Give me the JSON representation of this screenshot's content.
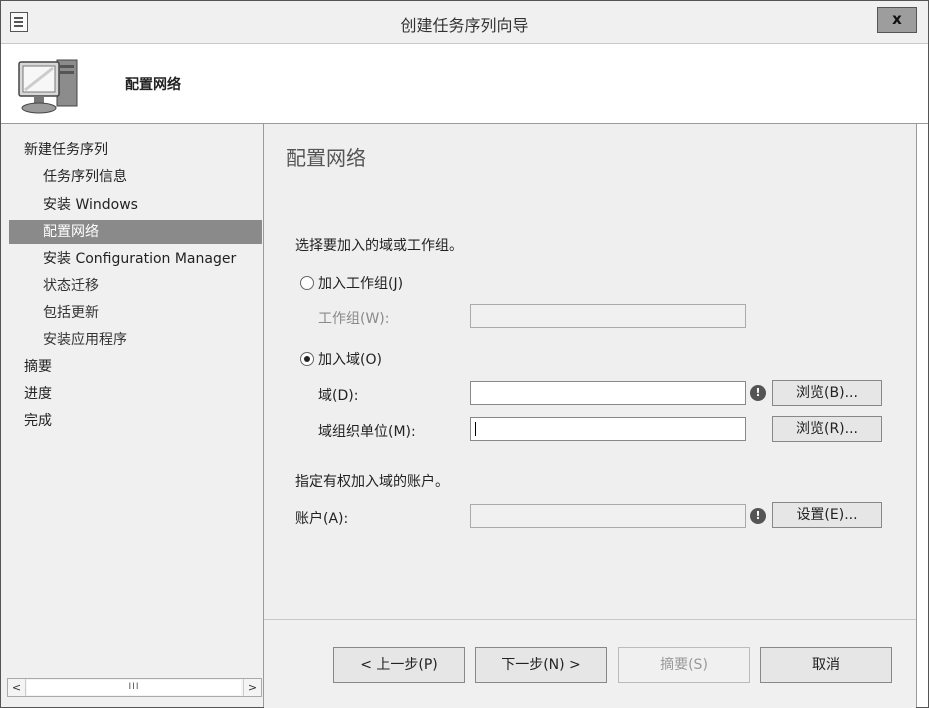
{
  "window": {
    "title": "创建任务序列向导",
    "close_label": "x"
  },
  "header": {
    "step_title": "配置网络"
  },
  "nav": {
    "items": [
      {
        "label": "新建任务序列"
      },
      {
        "label": "任务序列信息"
      },
      {
        "label": "安装 Windows"
      },
      {
        "label": "配置网络"
      },
      {
        "label": "安装 Configuration Manager"
      },
      {
        "label": "状态迁移"
      },
      {
        "label": "包括更新"
      },
      {
        "label": "安装应用程序"
      },
      {
        "label": "摘要"
      },
      {
        "label": "进度"
      },
      {
        "label": "完成"
      }
    ],
    "scrollbar": {
      "left": "<",
      "right": ">",
      "thumb": "III"
    }
  },
  "content": {
    "page_title": "配置网络",
    "prompt": "选择要加入的域或工作组。",
    "workgroup_radio": "加入工作组(J)",
    "workgroup_label": "工作组(W):",
    "workgroup_value": "",
    "domain_radio": "加入域(O)",
    "domain_label": "域(D):",
    "domain_value": "",
    "ou_label": "域组织单位(M):",
    "ou_value": "",
    "browse_domain": "浏览(B)...",
    "browse_ou": "浏览(R)...",
    "account_prompt": "指定有权加入域的账户。",
    "account_label": "账户(A):",
    "account_value": "",
    "set_button": "设置(E)...",
    "warning_icon": "!"
  },
  "footer": {
    "prev": "< 上一步(P)",
    "next": "下一步(N) >",
    "summary": "摘要(S)",
    "cancel": "取消"
  }
}
